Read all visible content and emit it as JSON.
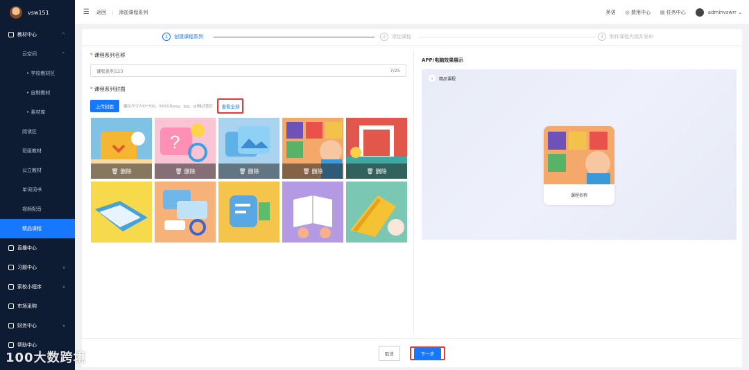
{
  "sidebar": {
    "username": "vsw151",
    "items": [
      {
        "label": "教材中心",
        "level": "top"
      },
      {
        "label": "云空间",
        "level": "sub"
      },
      {
        "label": "• 学校教材区",
        "level": "sub2"
      },
      {
        "label": "• 自制教材",
        "level": "sub2"
      },
      {
        "label": "• 素材库",
        "level": "sub2"
      },
      {
        "label": "阅读区",
        "level": "sub"
      },
      {
        "label": "班级教材",
        "level": "sub"
      },
      {
        "label": "公立教材",
        "level": "sub"
      },
      {
        "label": "单词词书",
        "level": "sub"
      },
      {
        "label": "视频配音",
        "level": "sub"
      },
      {
        "label": "精品课程",
        "level": "sub",
        "active": true
      },
      {
        "label": "直播中心",
        "level": "top"
      },
      {
        "label": "习题中心",
        "level": "top"
      },
      {
        "label": "家校小程序",
        "level": "top"
      },
      {
        "label": "市场采购",
        "level": "top"
      },
      {
        "label": "财务中心",
        "level": "top"
      },
      {
        "label": "帮助中心",
        "level": "top"
      }
    ]
  },
  "topbar": {
    "back": "返回",
    "title": "添加课程系列",
    "lang": "英语",
    "fee": "费用中心",
    "task": "任务中心",
    "admin": "adminvswrr"
  },
  "steps": [
    {
      "num": "1",
      "label": "创建课程系列"
    },
    {
      "num": "2",
      "label": "添加课程"
    },
    {
      "num": "3",
      "label": "制作课程大纲并发布"
    }
  ],
  "form": {
    "name_label": "课程系列名称",
    "name_value": "课程系列123",
    "name_count": "7/25",
    "cover_label": "课程系列封面",
    "upload_btn": "上传封面",
    "hint": "建议尺寸700*700，5M以内png、jpg、gif格式图片",
    "view_all": "查看全部",
    "delete_label": "删除"
  },
  "preview": {
    "title": "APP/电脑效果展示",
    "back_label": "精品课程",
    "card_caption": "课程名称"
  },
  "footer": {
    "cancel": "取消",
    "next": "下一步"
  },
  "watermark": "100大数跨境",
  "colors": {
    "accent": "#1677ff",
    "sidebar": "#0d1b33",
    "highlight": "#e53935"
  }
}
